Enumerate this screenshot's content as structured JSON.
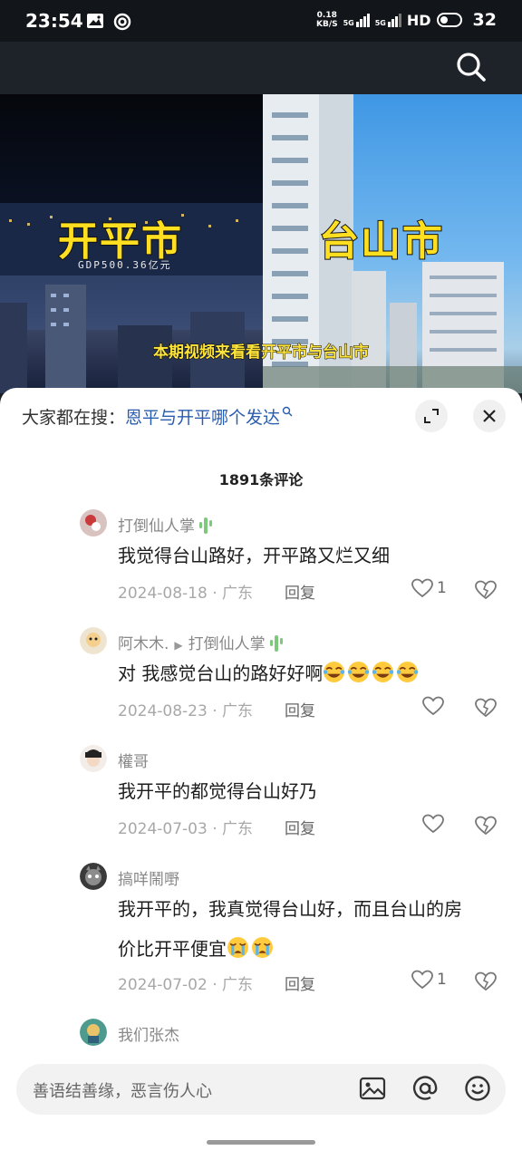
{
  "status_bar": {
    "time": "23:54",
    "net_speed_top": "0.18",
    "net_speed_bottom": "KB/S",
    "sig1": "5G",
    "sig2": "5G",
    "hd": "HD",
    "battery": "32"
  },
  "video": {
    "left_city": "开平市",
    "left_sub": "GDP500.36亿元",
    "right_city": "台山市",
    "caption": "本期视频来看看开平市与台山市"
  },
  "sheet": {
    "trending_prefix": "大家都在搜：",
    "trending_query": "恩平与开平哪个发达",
    "comment_count": "1891条评论"
  },
  "comments": [
    {
      "user": "打倒仙人掌",
      "reply_to": "",
      "text": "我觉得台山路好，开平路又烂又细",
      "date": "2024-08-18 · 广东",
      "reply": "回复",
      "likes": "1"
    },
    {
      "user": "阿木木.",
      "reply_to": "打倒仙人掌",
      "text": "对 我感觉台山的路好好啊",
      "date": "2024-08-23 · 广东",
      "reply": "回复",
      "likes": ""
    },
    {
      "user": "權哥",
      "reply_to": "",
      "text": "我开平的都觉得台山好乃",
      "date": "2024-07-03 · 广东",
      "reply": "回复",
      "likes": ""
    },
    {
      "user": "搞咩鬧嘢",
      "reply_to": "",
      "text_line1": "我开平的，我真觉得台山好，而且台山的房",
      "text_line2": "价比开平便宜",
      "date": "2024-07-02 · 广东",
      "reply": "回复",
      "likes": "1"
    },
    {
      "user": "我们张杰"
    }
  ],
  "input": {
    "placeholder": "善语结善缘，恶言伤人心"
  }
}
